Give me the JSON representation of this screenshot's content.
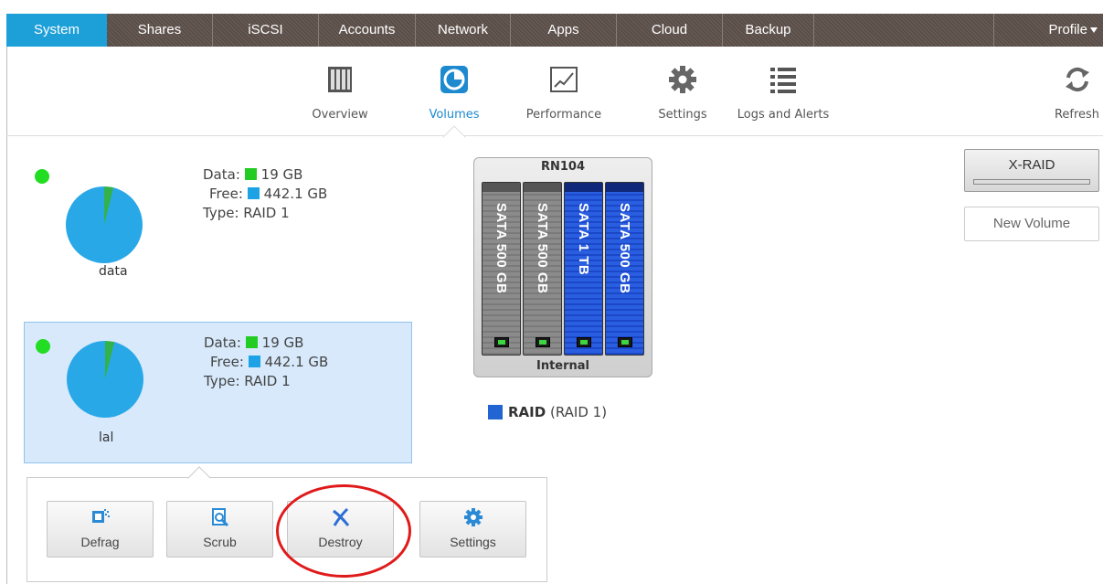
{
  "topnav": {
    "tabs": [
      {
        "label": "System"
      },
      {
        "label": "Shares"
      },
      {
        "label": "iSCSI"
      },
      {
        "label": "Accounts"
      },
      {
        "label": "Network"
      },
      {
        "label": "Apps"
      },
      {
        "label": "Cloud"
      },
      {
        "label": "Backup"
      }
    ],
    "active": "System",
    "profile_label": "Profile"
  },
  "subnav": {
    "items": [
      {
        "label": "Overview",
        "icon": "overview-icon"
      },
      {
        "label": "Volumes",
        "icon": "volumes-icon"
      },
      {
        "label": "Performance",
        "icon": "performance-icon"
      },
      {
        "label": "Settings",
        "icon": "settings-gear-icon"
      },
      {
        "label": "Logs and Alerts",
        "icon": "logs-list-icon"
      }
    ],
    "active": "Volumes",
    "refresh_label": "Refresh"
  },
  "volumes": [
    {
      "name": "data",
      "data_label": "Data:",
      "data_value": "19 GB",
      "free_label": "Free:",
      "free_value": "442.1 GB",
      "type_label": "Type:",
      "type_value": "RAID 1",
      "selected": false
    },
    {
      "name": "lal",
      "data_label": "Data:",
      "data_value": "19 GB",
      "free_label": "Free:",
      "free_value": "442.1 GB",
      "type_label": "Type:",
      "type_value": "RAID 1",
      "selected": true
    }
  ],
  "actions": {
    "defrag": "Defrag",
    "scrub": "Scrub",
    "destroy": "Destroy",
    "settings": "Settings"
  },
  "enclosure": {
    "title": "RN104",
    "footer": "Internal",
    "disks": [
      {
        "label": "SATA 500 GB",
        "color": "gray"
      },
      {
        "label": "SATA 500 GB",
        "color": "gray"
      },
      {
        "label": "SATA 1 TB",
        "color": "blue"
      },
      {
        "label": "SATA 500 GB",
        "color": "blue"
      }
    ]
  },
  "raid_legend": {
    "name": "RAID",
    "level": "(RAID 1)"
  },
  "right_panel": {
    "xraid_label": "X-RAID",
    "new_volume_label": "New Volume"
  },
  "colors": {
    "accent": "#1d9fd8",
    "data": "#22cc22",
    "free": "#1da2e6",
    "annotation": "#e01a1a"
  }
}
